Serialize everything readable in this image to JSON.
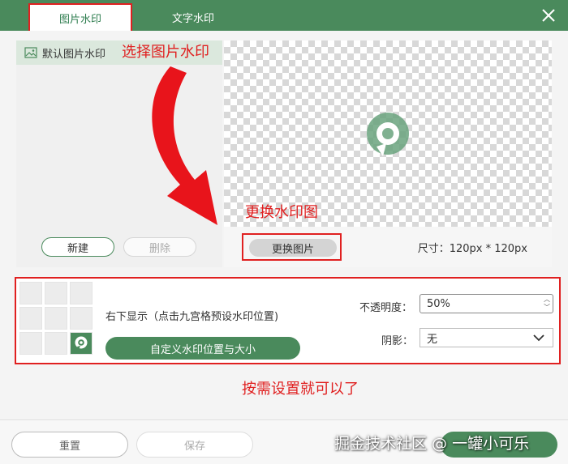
{
  "tabs": {
    "image_watermark": "图片水印",
    "text_watermark": "文字水印"
  },
  "left_panel": {
    "item_label": "默认图片水印",
    "new_label": "新建",
    "delete_label": "删除"
  },
  "info": {
    "change_image_label": "更换图片",
    "size_text": "尺寸：120px * 120px"
  },
  "settings": {
    "position_desc": "右下显示（点击九宫格预设水印位置)",
    "custom_button_label": "自定义水印位置与大小",
    "opacity_label": "不透明度：",
    "opacity_value": "50%",
    "shadow_label": "阴影：",
    "shadow_value": "无",
    "grid_active_index": 8
  },
  "annotations": {
    "select_image": "选择图片水印",
    "change_image": "更换水印图",
    "set_as_needed": "按需设置就可以了"
  },
  "footer": {
    "reset_label": "重置",
    "save_label": "保存",
    "watermark_text": "掘金技术社区 @ 一罐小可乐"
  },
  "colors": {
    "brand_green": "#4a8a5c",
    "annotation_red": "#e02020"
  },
  "icons": [
    "close-icon",
    "image-icon",
    "logo-icon",
    "chevron-down-icon",
    "spin-icon"
  ]
}
